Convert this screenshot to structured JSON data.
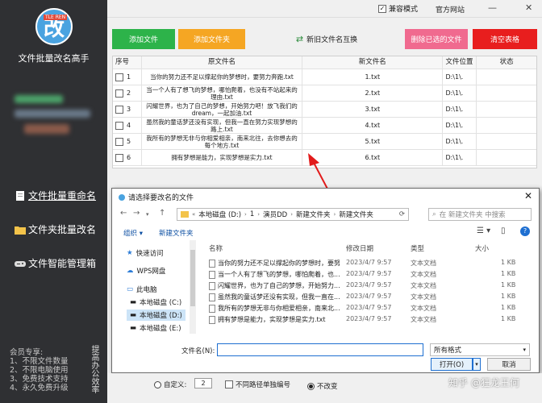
{
  "sidebar": {
    "logo_tag": "TLE REN",
    "logo_char": "改",
    "app_title": "文件批量改名高手",
    "nav": [
      {
        "label": "文件批量重命名",
        "icon": "document-icon"
      },
      {
        "label": "文件夹批量改名",
        "icon": "folder-icon"
      },
      {
        "label": "文件智能管理箱",
        "icon": "gamepad-icon"
      }
    ],
    "member_lines": [
      "会员专享:",
      "1、不限文件数量",
      "2、不限电脑使用",
      "3、免费技术支持",
      "4、永久免费升级"
    ],
    "vertical_text": "提高办公效率"
  },
  "topbar": {
    "compat_label": "兼容模式",
    "compat_checked": true,
    "site_label": "官方网站"
  },
  "actions": {
    "add_file": "添加文件",
    "add_folder": "添加文件夹",
    "swap": "新旧文件名互换",
    "delete_selected": "删除已选的文件",
    "clear_table": "清空表格"
  },
  "table": {
    "headers": [
      "序号",
      "原文件名",
      "新文件名",
      "文件位置",
      "状态"
    ],
    "rows": [
      {
        "no": "1",
        "orig": "当你的努力还不足以撑起你的梦想时，要努力奔跑.txt",
        "new": "1.txt",
        "loc": "D:\\1\\."
      },
      {
        "no": "2",
        "orig": "当一个人有了想飞的梦想，哪怕爬着，也没有不站起来的理由.txt",
        "new": "2.txt",
        "loc": "D:\\1\\."
      },
      {
        "no": "3",
        "orig": "闪耀世界，也为了自己的梦想，开始努力吧！放飞我们的dream，一起加油.txt",
        "new": "3.txt",
        "loc": "D:\\1\\."
      },
      {
        "no": "4",
        "orig": "虽然我的童话梦还没有实现，但我一直在努力实现梦想的路上.txt",
        "new": "4.txt",
        "loc": "D:\\1\\."
      },
      {
        "no": "5",
        "orig": "我所有的梦想无非与你相爱相亲，南来北往，去你想去的每个地方.txt",
        "new": "5.txt",
        "loc": "D:\\1\\."
      },
      {
        "no": "6",
        "orig": "拥有梦想是能力，实现梦想是实力.txt",
        "new": "6.txt",
        "loc": "D:\\1\\."
      }
    ]
  },
  "dialog": {
    "title": "请选择要改名的文件",
    "path": [
      "本地磁盘 (D:)",
      "1",
      "演员DD",
      "新建文件夹",
      "新建文件夹"
    ],
    "search_placeholder": "在 新建文件夹 中搜索",
    "organize": "组织 ▾",
    "new_folder": "新建文件夹",
    "tree": [
      "快速访问",
      "WPS网盘",
      "此电脑",
      "本地磁盘 (C:)",
      "本地磁盘 (D:)",
      "本地磁盘 (E:)"
    ],
    "columns": [
      "名称",
      "修改日期",
      "类型",
      "大小"
    ],
    "files": [
      {
        "name": "当你的努力还不足以撑起你的梦想时，要努...",
        "date": "2023/4/7 9:57",
        "type": "文本文档",
        "size": "1 KB"
      },
      {
        "name": "当一个人有了想飞的梦想，哪怕爬着，也...",
        "date": "2023/4/7 9:57",
        "type": "文本文档",
        "size": "1 KB"
      },
      {
        "name": "闪耀世界，也为了自己的梦想，开始努力...",
        "date": "2023/4/7 9:57",
        "type": "文本文档",
        "size": "1 KB"
      },
      {
        "name": "虽然我的童话梦还没有实现，但我一直在...",
        "date": "2023/4/7 9:57",
        "type": "文本文档",
        "size": "1 KB"
      },
      {
        "name": "我所有的梦想无非与你相爱相亲，南来北...",
        "date": "2023/4/7 9:57",
        "type": "文本文档",
        "size": "1 KB"
      },
      {
        "name": "拥有梦想是能力，实现梦想是实力.txt",
        "date": "2023/4/7 9:57",
        "type": "文本文档",
        "size": "1 KB"
      }
    ],
    "filename_label": "文件名(N):",
    "filename_value": "",
    "format": "所有格式",
    "open": "打开(O)",
    "cancel": "取消"
  },
  "bottom": {
    "custom_label": "自定义:",
    "custom_value": "2",
    "keep_path_label": "不同路径单独编号",
    "no_change_label": "不改变"
  },
  "watermark": "知乎 @狂龙王何"
}
